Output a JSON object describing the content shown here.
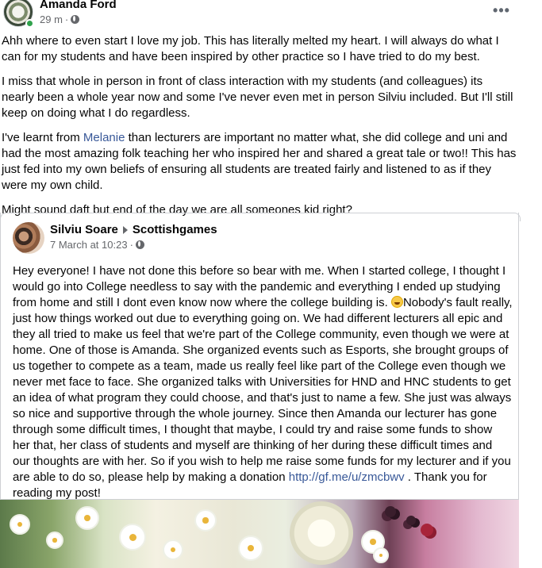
{
  "post": {
    "author": "Amanda Ford",
    "time": "29 m",
    "separator": "·",
    "more_label": "•••",
    "paragraphs": {
      "p1": "Ahh where to even start I love my job. This has literally melted my heart. I will always do what I can for my students and have been inspired by other practice so I have tried to do my best.",
      "p2": "I miss that whole in person in front of class interaction with my students (and colleagues) its nearly been a whole year now and some I've never even met in person Silviu included. But I'll still keep on doing what I do regardless.",
      "p3_before": "I've learnt from ",
      "p3_mention": "Melanie",
      "p3_after": " than lecturers are important no matter what, she did college and uni and had the most amazing folk teaching her who inspired her and shared a great tale or two!! This has just fed into my own beliefs of ensuring all students are treated  fairly and listened to as if they were my own child.",
      "p4": "Might sound daft but end of the day we are all someones kid right?"
    }
  },
  "shared": {
    "author": "Silviu Soare",
    "group": "Scottishgames",
    "date": "7 March at 10:23",
    "separator": "·",
    "text_part1": "Hey everyone! I have not done this before so bear with me. When I started college, I thought I would go into College needless to say with the pandemic and everything I ended up studying from home and still I dont even know now where the college building is. ",
    "text_part2": "Nobody's fault really, just how things worked out due to everything going on. We had different lecturers all epic and they all tried to make us feel that we're part of the College community, even though we were at home. One of those is Amanda. She organized events such as Esports, she brought groups of us together to compete as a team, made us really feel like part of the College even though we never met face to face. She organized talks with Universities for HND and HNC students to get an idea of what program they could choose, and that's just to name a few. She just was always so nice and supportive through the whole journey. Since then Amanda our lecturer has gone through some difficult times, I thought that maybe, I could try and raise some funds to show her that, her class of students and myself are thinking of her during these difficult times and our thoughts are with her. So if you wish to help me raise some funds for my lecturer and if you are able to do so, please help by making a donation ",
    "link": "http://gf.me/u/zmcbwv",
    "text_part3": " . Thank you for reading my post!"
  },
  "icons": {
    "globe": "globe-icon",
    "more": "more-horizontal-icon",
    "arrow": "triangle-right-icon",
    "emoji": "grinning-face-icon"
  },
  "colors": {
    "link": "#385898",
    "meta": "#65676b",
    "online": "#31a24c"
  }
}
